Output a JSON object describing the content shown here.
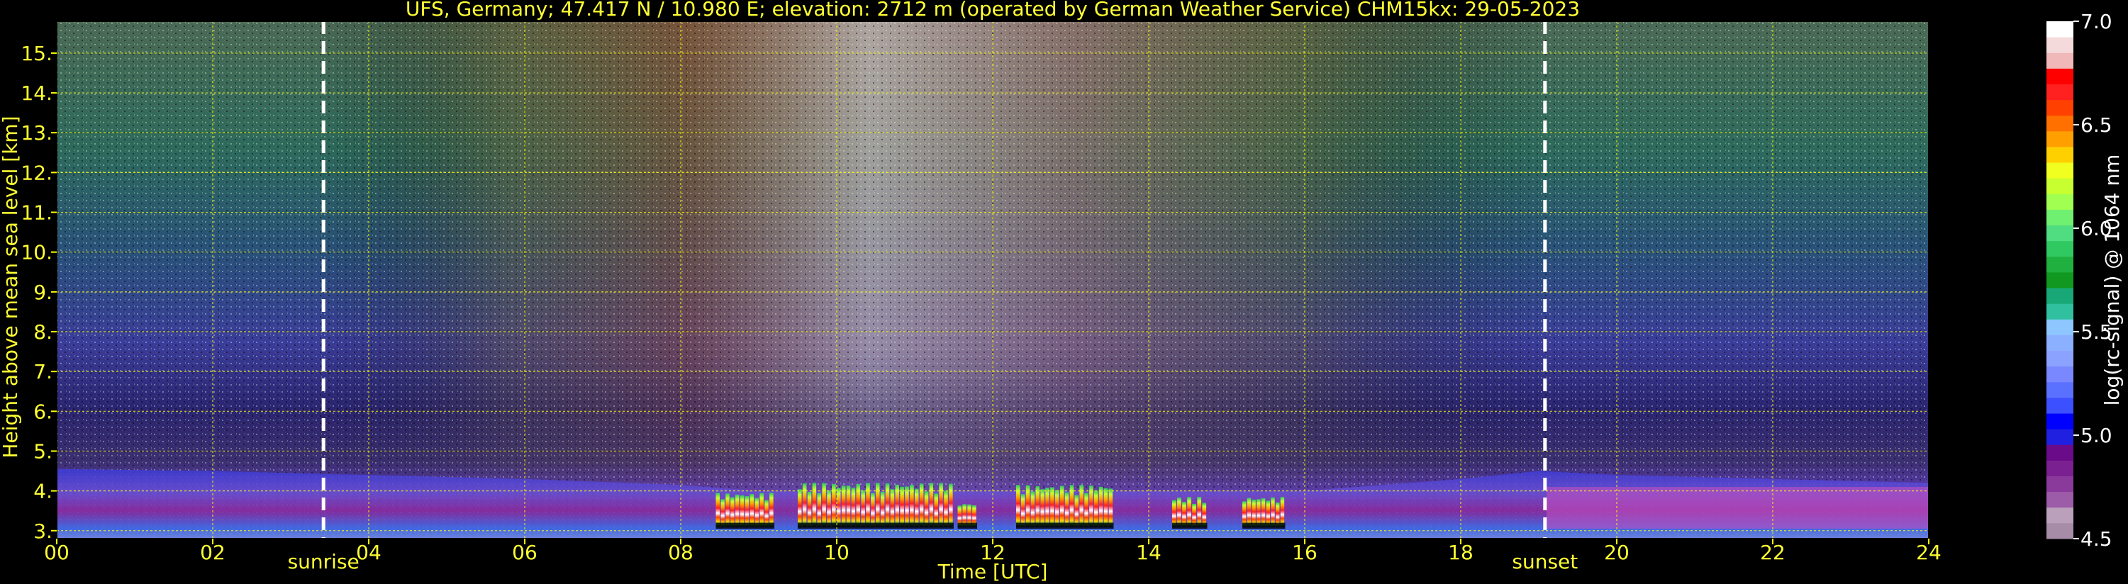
{
  "chart_data": {
    "type": "heatmap",
    "title": "UFS, Germany; 47.417 N / 10.980 E; elevation: 2712 m  (operated by German Weather Service)    CHM15kx: 29-05-2023",
    "xlabel": "Time [UTC]",
    "ylabel": "Height above mean sea level [km]",
    "xlim": [
      0,
      24
    ],
    "ylim": [
      2.8,
      15.8
    ],
    "x_ticks": [
      0,
      2,
      4,
      6,
      8,
      10,
      12,
      14,
      16,
      18,
      20,
      22,
      24
    ],
    "x_tick_labels": [
      "00",
      "02",
      "04",
      "06",
      "08",
      "10",
      "12",
      "14",
      "16",
      "18",
      "20",
      "22",
      "24"
    ],
    "y_ticks": [
      3,
      4,
      5,
      6,
      7,
      8,
      9,
      10,
      11,
      12,
      13,
      14,
      15
    ],
    "y_tick_labels": [
      "3.",
      "4.",
      "5.",
      "6.",
      "7.",
      "8.",
      "9.",
      "10.",
      "11.",
      "12.",
      "13.",
      "14.",
      "15."
    ],
    "grid": true,
    "events": [
      {
        "name": "sunrise",
        "time": 3.42
      },
      {
        "name": "sunset",
        "time": 19.08
      }
    ],
    "colorbar": {
      "label": "log(rc-signal) @ 1064 nm",
      "min": 4.5,
      "max": 7.0,
      "ticks": [
        4.5,
        5.0,
        5.5,
        6.0,
        6.5,
        7.0
      ],
      "tick_labels": [
        "4.5",
        "5.0",
        "5.5",
        "6.0",
        "6.5",
        "7.0"
      ],
      "colors": [
        "#a68ca6",
        "#bba0bb",
        "#9c5ca8",
        "#8a3a9a",
        "#7a2090",
        "#6a0b8a",
        "#2020e0",
        "#0000ff",
        "#3c50ff",
        "#5a70ff",
        "#7a88ff",
        "#8ca2ff",
        "#8ab0ff",
        "#8ec6ff",
        "#30c0a0",
        "#18a878",
        "#109820",
        "#20b040",
        "#30c860",
        "#50dc80",
        "#70f070",
        "#a0ff50",
        "#c8ff30",
        "#f0ff20",
        "#ffd000",
        "#ffa000",
        "#ff7000",
        "#ff4000",
        "#ff2020",
        "#ff0000",
        "#f0b8b8",
        "#f4dada",
        "#ffffff"
      ]
    },
    "cloud_segments": [
      {
        "t0": 8.45,
        "t1": 9.2,
        "top": 3.95,
        "base": 3.1
      },
      {
        "t0": 9.5,
        "t1": 11.5,
        "top": 4.2,
        "base": 3.1
      },
      {
        "t0": 11.55,
        "t1": 11.8,
        "top": 3.7,
        "base": 3.1
      },
      {
        "t0": 12.3,
        "t1": 13.55,
        "top": 4.15,
        "base": 3.1
      },
      {
        "t0": 14.3,
        "t1": 14.75,
        "top": 3.85,
        "base": 3.1
      },
      {
        "t0": 15.2,
        "t1": 15.75,
        "top": 3.85,
        "base": 3.1
      }
    ]
  }
}
